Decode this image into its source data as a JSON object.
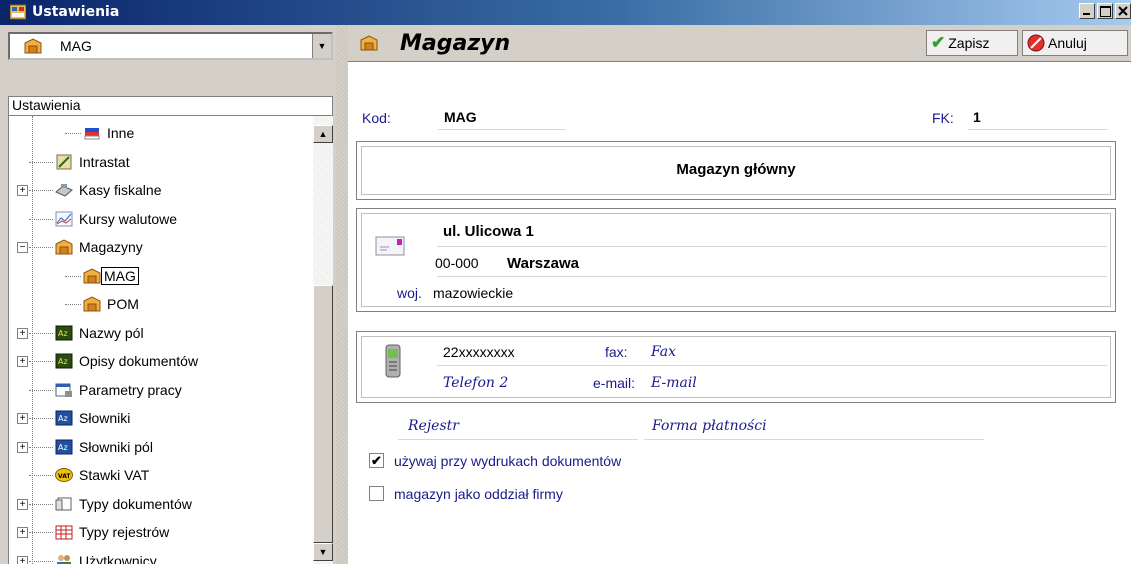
{
  "window": {
    "title": "Ustawienia"
  },
  "selector": {
    "value": "MAG"
  },
  "tree": {
    "header": "Ustawienia",
    "items": [
      {
        "label": "Inne",
        "icon": "flag-icon",
        "level": 2,
        "expander": "",
        "selected": false
      },
      {
        "label": "Intrastat",
        "icon": "intrastat-icon",
        "level": 1,
        "expander": "",
        "selected": false
      },
      {
        "label": "Kasy fiskalne",
        "icon": "cash-register-icon",
        "level": 1,
        "expander": "+",
        "selected": false
      },
      {
        "label": "Kursy walutowe",
        "icon": "chart-icon",
        "level": 1,
        "expander": "",
        "selected": false
      },
      {
        "label": "Magazyny",
        "icon": "warehouse-icon",
        "level": 1,
        "expander": "−",
        "selected": false
      },
      {
        "label": "MAG",
        "icon": "warehouse-icon",
        "level": 2,
        "expander": "",
        "selected": true
      },
      {
        "label": "POM",
        "icon": "warehouse-icon",
        "level": 2,
        "expander": "",
        "selected": false
      },
      {
        "label": "Nazwy pól",
        "icon": "az-icon",
        "level": 1,
        "expander": "+",
        "selected": false
      },
      {
        "label": "Opisy dokumentów",
        "icon": "az-icon",
        "level": 1,
        "expander": "+",
        "selected": false
      },
      {
        "label": "Parametry pracy",
        "icon": "settings-window-icon",
        "level": 1,
        "expander": "",
        "selected": false
      },
      {
        "label": "Słowniki",
        "icon": "az-blue-icon",
        "level": 1,
        "expander": "+",
        "selected": false
      },
      {
        "label": "Słowniki pól",
        "icon": "az-blue-icon",
        "level": 1,
        "expander": "+",
        "selected": false
      },
      {
        "label": "Stawki VAT",
        "icon": "vat-icon",
        "level": 1,
        "expander": "",
        "selected": false
      },
      {
        "label": "Typy dokumentów",
        "icon": "document-icon",
        "level": 1,
        "expander": "+",
        "selected": false
      },
      {
        "label": "Typy rejestrów",
        "icon": "register-icon",
        "level": 1,
        "expander": "+",
        "selected": false
      },
      {
        "label": "Użytkownicy",
        "icon": "users-icon",
        "level": 1,
        "expander": "+",
        "selected": false
      }
    ]
  },
  "panel": {
    "title": "Magazyn",
    "save_label": "Zapisz",
    "cancel_label": "Anuluj",
    "kod_label": "Kod:",
    "kod_value": "MAG",
    "fk_label": "FK:",
    "fk_value": "1",
    "name": "Magazyn główny",
    "street": "ul. Ulicowa 1",
    "postal_code": "00-000",
    "city": "Warszawa",
    "woj_label": "woj.",
    "woj_value": "mazowieckie",
    "phone1": "22xxxxxxxx",
    "fax_label": "fax:",
    "fax_value": "Fax",
    "phone2": "Telefon 2",
    "email_label": "e-mail:",
    "email_value": "E-mail",
    "rejestr": "Rejestr",
    "forma": "Forma płatności",
    "check1_label": "używaj przy wydrukach dokumentów",
    "check1_checked": true,
    "check2_label": "magazyn jako oddział firmy",
    "check2_checked": false
  }
}
